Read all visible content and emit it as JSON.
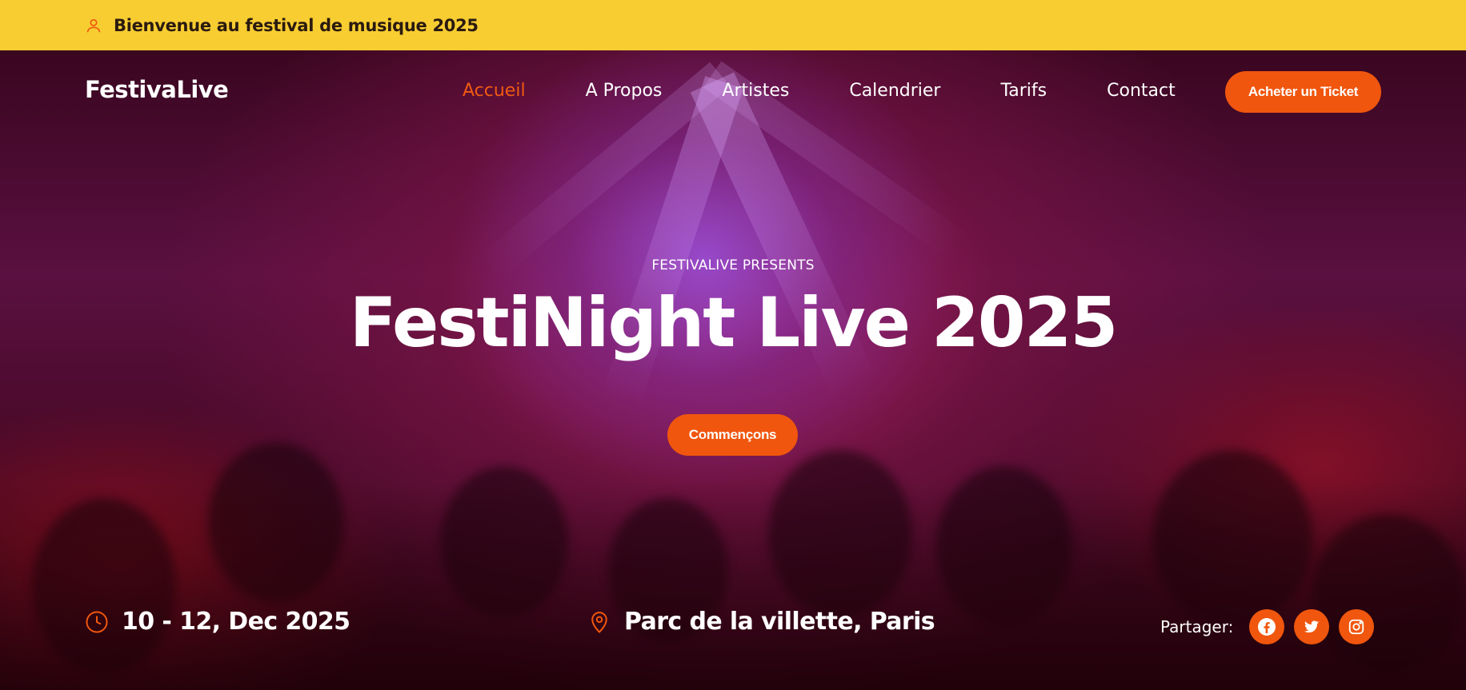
{
  "topbar": {
    "welcome_text": "Bienvenue au festival de musique 2025",
    "icon": "user-icon"
  },
  "nav": {
    "brand": "FestivaLive",
    "items": [
      {
        "label": "Accueil",
        "active": true
      },
      {
        "label": "A Propos",
        "active": false
      },
      {
        "label": "Artistes",
        "active": false
      },
      {
        "label": "Calendrier",
        "active": false
      },
      {
        "label": "Tarifs",
        "active": false
      },
      {
        "label": "Contact",
        "active": false
      }
    ],
    "ticket_button": "Acheter un Ticket"
  },
  "hero": {
    "eyebrow": "FESTIVALIVE PRESENTS",
    "title": "FestiNight Live 2025",
    "cta": "Commençons"
  },
  "info": {
    "date": "10 - 12, Dec 2025",
    "date_icon": "clock-icon",
    "location": "Parc de la villette, Paris",
    "location_icon": "map-pin-icon"
  },
  "share": {
    "label": "Partager:",
    "networks": [
      "facebook-icon",
      "twitter-icon",
      "instagram-icon"
    ]
  },
  "colors": {
    "topbar_bg": "#f8cd31",
    "accent": "#f0560d",
    "text_light": "#ffffff"
  }
}
